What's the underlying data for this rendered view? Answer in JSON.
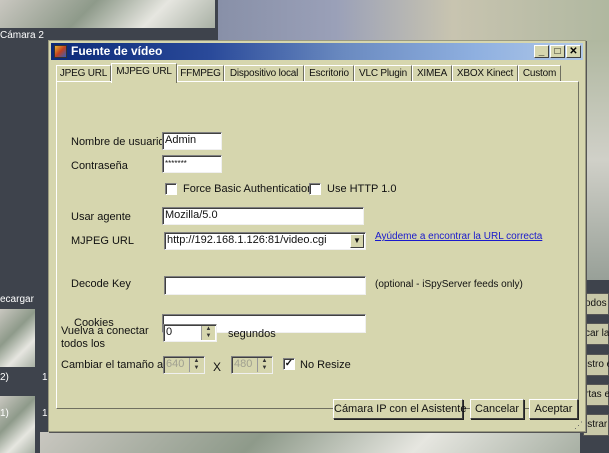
{
  "background": {
    "camera_label": "Cámara 2",
    "recargar_label": "ecargar",
    "thumb_labels": [
      "2)",
      "1",
      "1)",
      "1"
    ],
    "side_buttons": [
      "odos",
      "car la",
      "istro e",
      "rtas e",
      "istrar"
    ]
  },
  "dialog": {
    "title": "Fuente de vídeo",
    "controls": {
      "minimize": "_",
      "maximize": "□",
      "close": "✕"
    },
    "tabs": [
      "JPEG URL",
      "MJPEG URL",
      "FFMPEG",
      "Dispositivo local",
      "Escritorio",
      "VLC Plugin",
      "XIMEA",
      "XBOX Kinect",
      "Custom"
    ],
    "active_tab": "MJPEG URL",
    "form": {
      "username_label": "Nombre de usuario",
      "username_value": "Admin",
      "password_label": "Contraseña",
      "password_value": "*******",
      "force_basic_auth_label": "Force Basic Authentication",
      "force_basic_auth_checked": false,
      "use_http10_label": "Use HTTP 1.0",
      "use_http10_checked": false,
      "user_agent_label": "Usar agente",
      "user_agent_value": "Mozilla/5.0",
      "mjpeg_url_label": "MJPEG URL",
      "mjpeg_url_value": "http://192.168.1.126:81/video.cgi",
      "help_link": "Ayúdeme a encontrar la URL correcta",
      "decode_key_label": "Decode Key",
      "decode_key_value": "",
      "decode_key_note": "(optional - iSpyServer feeds only)",
      "cookies_label": "Cookies",
      "cookies_value": ""
    },
    "reconnect_label_1": "Vuelva a conectar",
    "reconnect_label_2": "todos los",
    "reconnect_value": "0",
    "reconnect_unit": "segundos",
    "resize_label": "Cambiar el tamaño a",
    "resize_width": "640",
    "resize_x": "X",
    "resize_height": "480",
    "no_resize_label": "No Resize",
    "no_resize_checked": true,
    "buttons": {
      "wizard": "Cámara IP con el Asistente",
      "cancel": "Cancelar",
      "accept": "Aceptar"
    }
  }
}
